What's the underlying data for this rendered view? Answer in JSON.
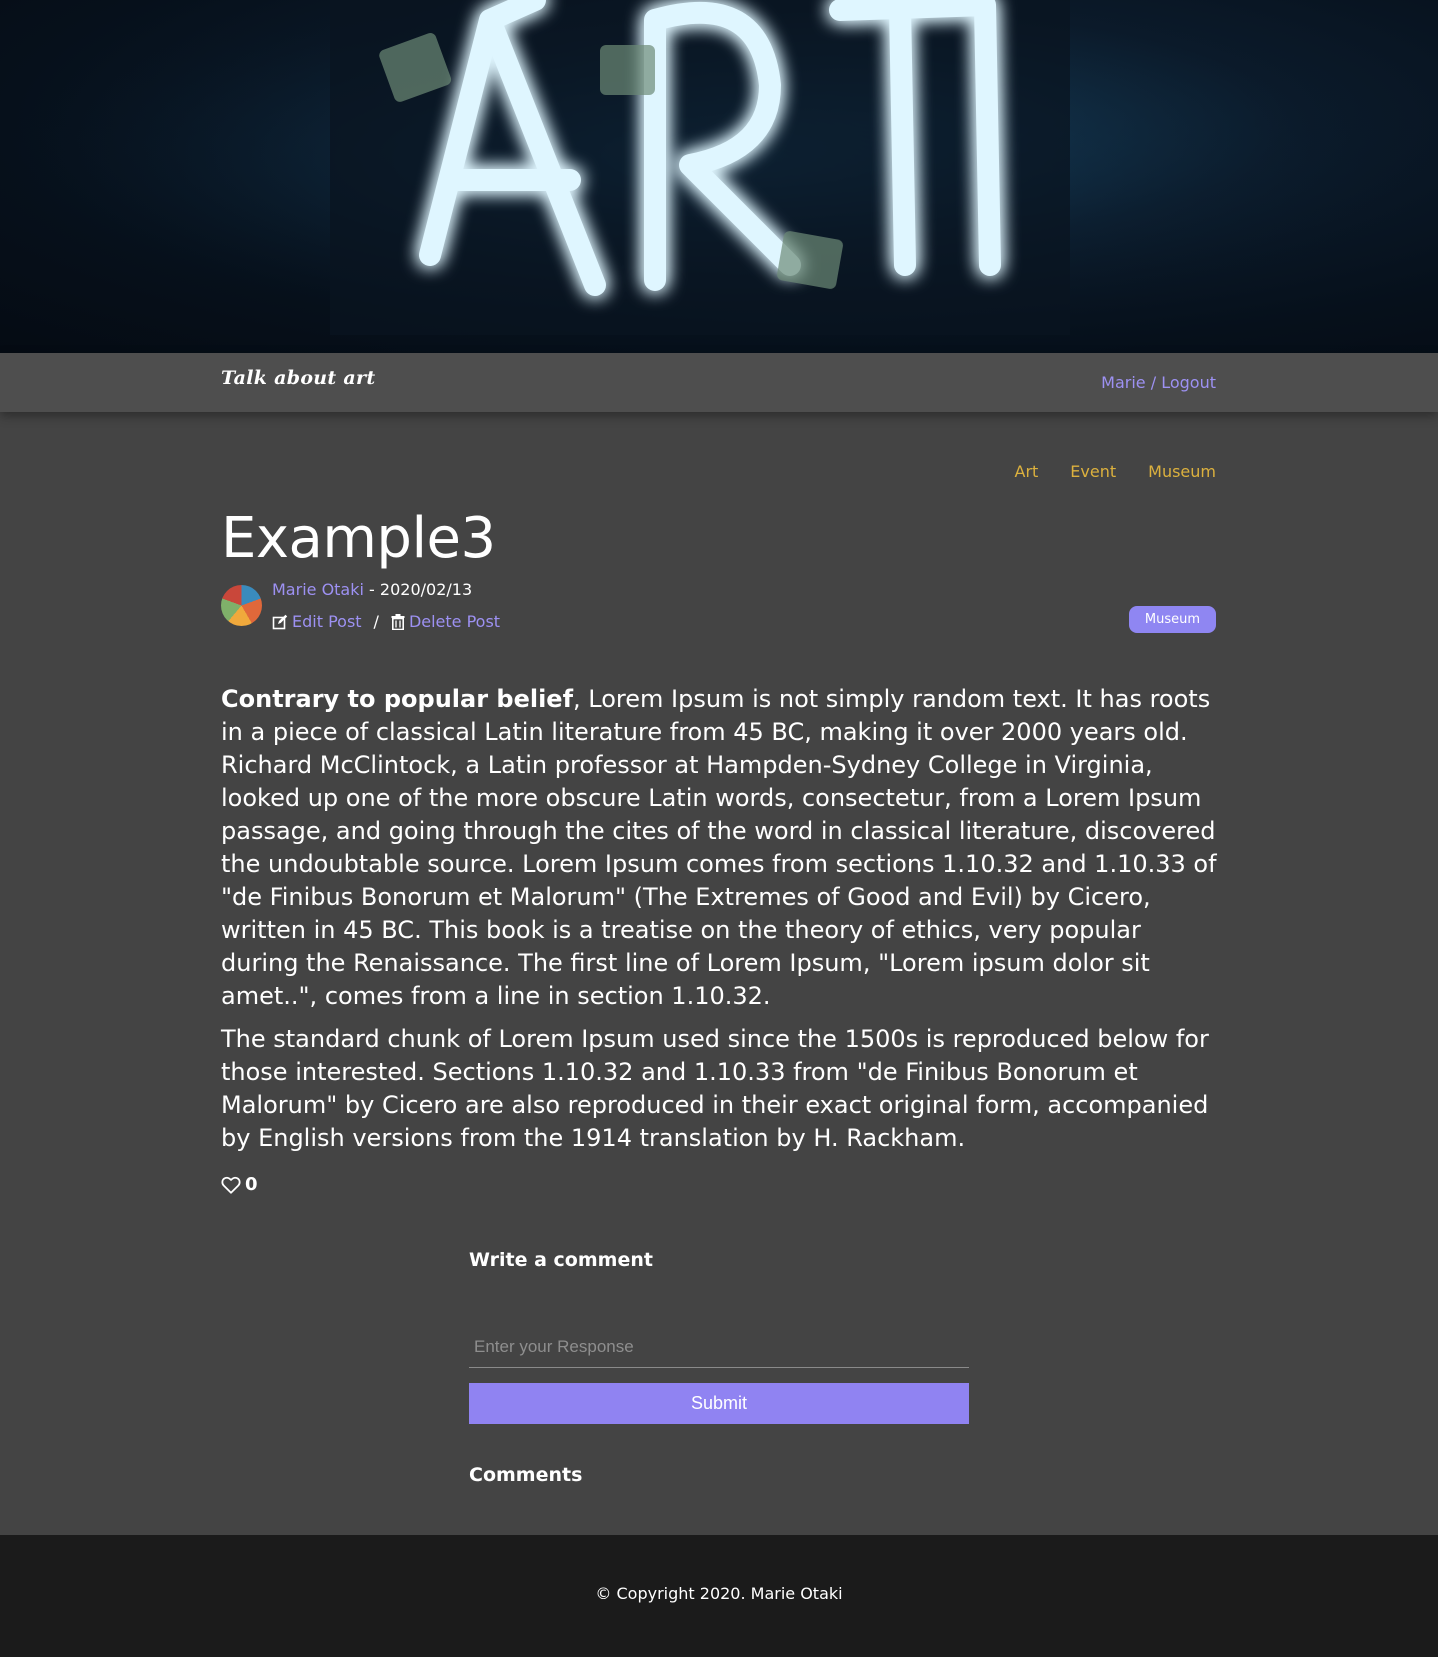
{
  "hero": {
    "sign_text": "ART"
  },
  "navbar": {
    "brand": "Talk about art",
    "user_link": "Marie / Logout"
  },
  "categories": [
    "Art",
    "Event",
    "Museum"
  ],
  "post": {
    "title": "Example3",
    "author": "Marie Otaki",
    "date_sep": " - ",
    "date": "2020/02/13",
    "edit_label": "Edit Post",
    "action_sep": "/",
    "delete_label": "Delete Post",
    "tag": "Museum",
    "lead_bold": "Contrary to popular belief",
    "paragraph1_rest": ", Lorem Ipsum is not simply random text. It has roots in a piece of classical Latin literature from 45 BC, making it over 2000 years old. Richard McClintock, a Latin professor at Hampden-Sydney College in Virginia, looked up one of the more obscure Latin words, consectetur, from a Lorem Ipsum passage, and going through the cites of the word in classical literature, discovered the undoubtable source. Lorem Ipsum comes from sections 1.10.32 and 1.10.33 of \"de Finibus Bonorum et Malorum\" (The Extremes of Good and Evil) by Cicero, written in 45 BC. This book is a treatise on the theory of ethics, very popular during the Renaissance. The first line of Lorem Ipsum, \"Lorem ipsum dolor sit amet..\", comes from a line in section 1.10.32.",
    "paragraph2": "The standard chunk of Lorem Ipsum used since the 1500s is reproduced below for those interested. Sections 1.10.32 and 1.10.33 from \"de Finibus Bonorum et Malorum\" by Cicero are also reproduced in their exact original form, accompanied by English versions from the 1914 translation by H. Rackham.",
    "like_count": "0"
  },
  "comment_form": {
    "heading": "Write a comment",
    "placeholder": "Enter your Response",
    "value": "",
    "submit_label": "Submit",
    "comments_heading": "Comments"
  },
  "footer": {
    "copyright": "© Copyright 2020. Marie Otaki"
  },
  "colors": {
    "accent": "#9d91f2",
    "category": "#dcb13e",
    "background": "#444444",
    "footer": "#1b1b1b"
  },
  "icons": {
    "edit": "edit-icon",
    "delete": "trash-icon",
    "like": "heart-icon"
  }
}
